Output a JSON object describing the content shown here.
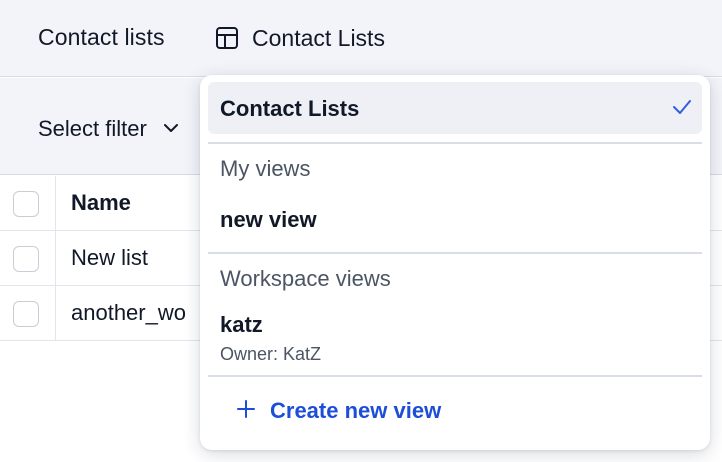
{
  "header": {
    "title": "Contact lists",
    "view_switch_label": "Contact Lists"
  },
  "filter": {
    "select_label": "Select filter"
  },
  "table": {
    "header": "Name",
    "rows": [
      "New list",
      "another_wo"
    ]
  },
  "dropdown": {
    "selected_view": "Contact Lists",
    "my_views_label": "My views",
    "my_views": [
      "new view"
    ],
    "workspace_views_label": "Workspace views",
    "workspace_views": [
      {
        "name": "katz",
        "owner": "Owner: KatZ"
      }
    ],
    "create_label": "Create new view"
  },
  "colors": {
    "accent": "#1d4ed8",
    "header_bg": "#f3f4f9",
    "selected_bg": "#eef0f6"
  }
}
